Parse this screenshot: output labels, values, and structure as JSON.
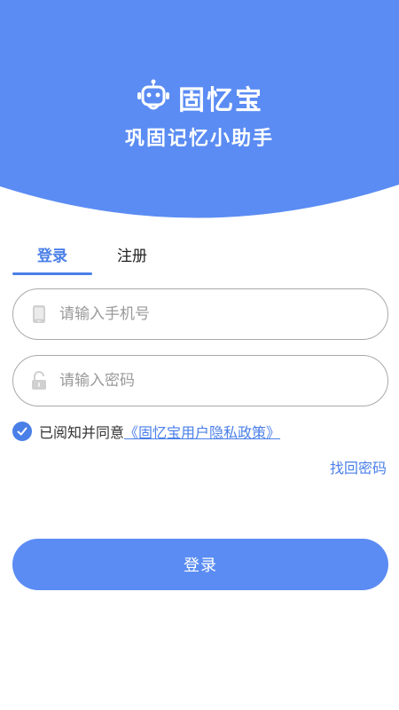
{
  "brand": {
    "name": "固忆宝",
    "slogan": "巩固记忆小助手",
    "logo_icon": "robot-icon"
  },
  "tabs": [
    {
      "label": "登录",
      "active": true
    },
    {
      "label": "注册",
      "active": false
    }
  ],
  "phone": {
    "placeholder": "请输入手机号",
    "value": "",
    "icon": "phone-icon"
  },
  "password": {
    "placeholder": "请输入密码",
    "value": "",
    "icon": "lock-icon"
  },
  "agreement": {
    "checked": true,
    "text": "已阅知并同意",
    "link_text": "《固忆宝用户隐私政策》"
  },
  "forgot_label": "找回密码",
  "login_label": "登录",
  "colors": {
    "primary": "#5b8cf3",
    "accent": "#4a7fe8",
    "header_bg": "#5b8cf3"
  }
}
